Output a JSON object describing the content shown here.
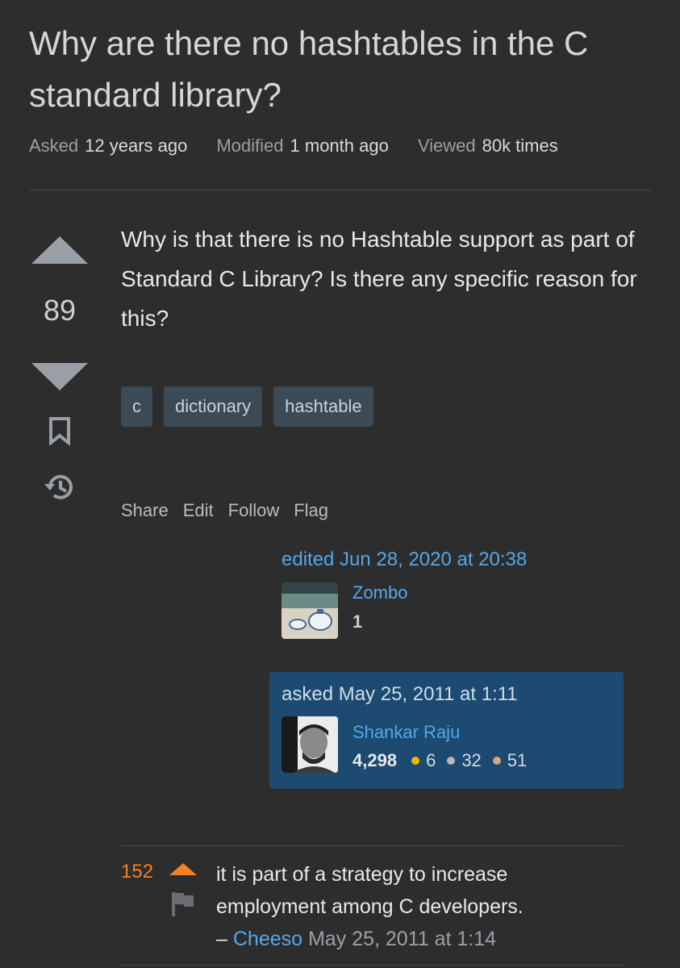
{
  "question": {
    "title": "Why are there no hashtables in the C standard library?",
    "meta": {
      "asked_label": "Asked",
      "asked_value": "12 years ago",
      "modified_label": "Modified",
      "modified_value": "1 month ago",
      "viewed_label": "Viewed",
      "viewed_value": "80k times"
    },
    "score": "89",
    "body": "Why is that there is no Hashtable support as part of Standard C Library? Is there any specific reason for this?",
    "tags": [
      "c",
      "dictionary",
      "hashtable"
    ],
    "actions": [
      "Share",
      "Edit",
      "Follow",
      "Flag"
    ],
    "edited": {
      "when": "edited Jun 28, 2020 at 20:38",
      "user": "Zombo",
      "rep": "1"
    },
    "asked": {
      "when": "asked May 25, 2011 at 1:11",
      "user": "Shankar Raju",
      "rep": "4,298",
      "gold": "6",
      "silver": "32",
      "bronze": "51"
    }
  },
  "comment": {
    "score": "152",
    "text": "it is part of a strategy to increase employment among C developers.",
    "dash": "–",
    "author": "Cheeso",
    "date": "May 25, 2011 at 1:14"
  },
  "colors": {
    "background": "#2d2d2d",
    "link": "#55a7e8",
    "accent": "#f48024",
    "card": "#1c4a70",
    "gold": "#f1b600",
    "silver": "#b4b8bc",
    "bronze": "#d1a684"
  }
}
